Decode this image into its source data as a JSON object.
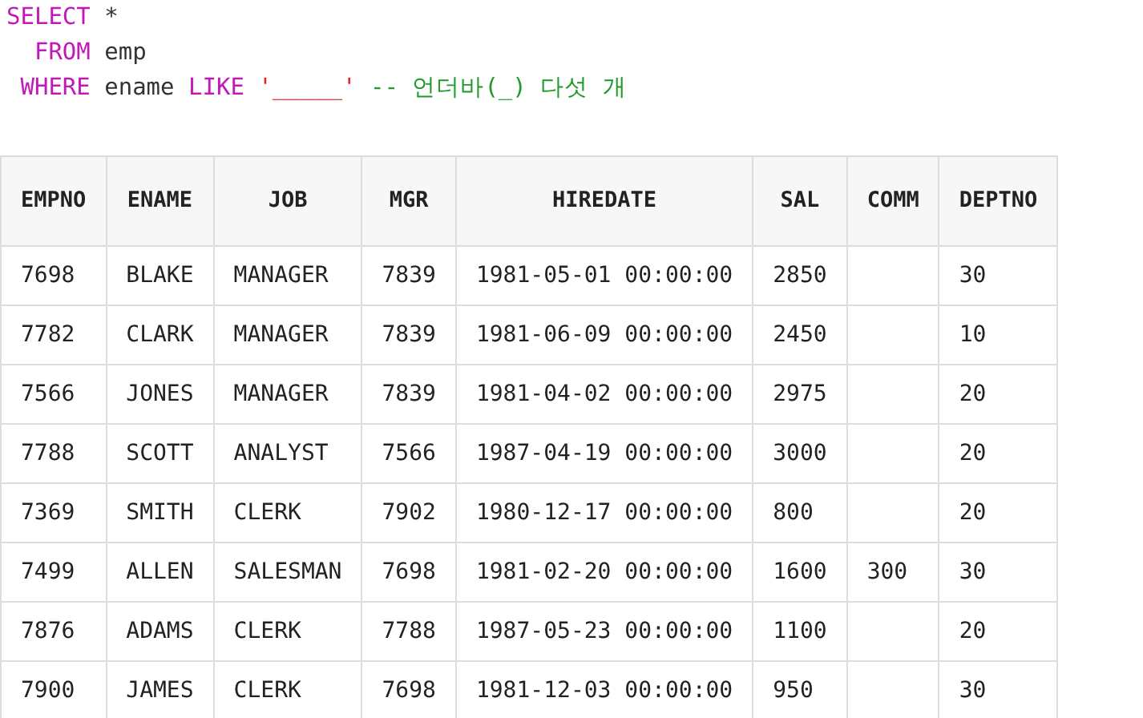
{
  "code": {
    "lines": [
      [
        {
          "kind": "keyword",
          "text": "SELECT"
        },
        {
          "kind": "plain",
          "text": " *"
        }
      ],
      [
        {
          "kind": "keyword",
          "text": "  FROM"
        },
        {
          "kind": "plain",
          "text": " emp"
        }
      ],
      [
        {
          "kind": "keyword",
          "text": " WHERE"
        },
        {
          "kind": "plain",
          "text": " ename "
        },
        {
          "kind": "keyword",
          "text": "LIKE "
        },
        {
          "kind": "string",
          "text": "'_____' "
        },
        {
          "kind": "comment",
          "text": "-- 언더바(_) 다섯 개"
        }
      ]
    ]
  },
  "table": {
    "columns": [
      "EMPNO",
      "ENAME",
      "JOB",
      "MGR",
      "HIREDATE",
      "SAL",
      "COMM",
      "DEPTNO"
    ],
    "rows": [
      [
        "7698",
        "BLAKE",
        "MANAGER",
        "7839",
        "1981-05-01 00:00:00",
        "2850",
        null,
        "30"
      ],
      [
        "7782",
        "CLARK",
        "MANAGER",
        "7839",
        "1981-06-09 00:00:00",
        "2450",
        null,
        "10"
      ],
      [
        "7566",
        "JONES",
        "MANAGER",
        "7839",
        "1981-04-02 00:00:00",
        "2975",
        null,
        "20"
      ],
      [
        "7788",
        "SCOTT",
        "ANALYST",
        "7566",
        "1987-04-19 00:00:00",
        "3000",
        null,
        "20"
      ],
      [
        "7369",
        "SMITH",
        "CLERK",
        "7902",
        "1980-12-17 00:00:00",
        "800",
        null,
        "20"
      ],
      [
        "7499",
        "ALLEN",
        "SALESMAN",
        "7698",
        "1981-02-20 00:00:00",
        "1600",
        "300",
        "30"
      ],
      [
        "7876",
        "ADAMS",
        "CLERK",
        "7788",
        "1987-05-23 00:00:00",
        "1100",
        null,
        "20"
      ],
      [
        "7900",
        "JAMES",
        "CLERK",
        "7698",
        "1981-12-03 00:00:00",
        "950",
        null,
        "30"
      ]
    ]
  }
}
